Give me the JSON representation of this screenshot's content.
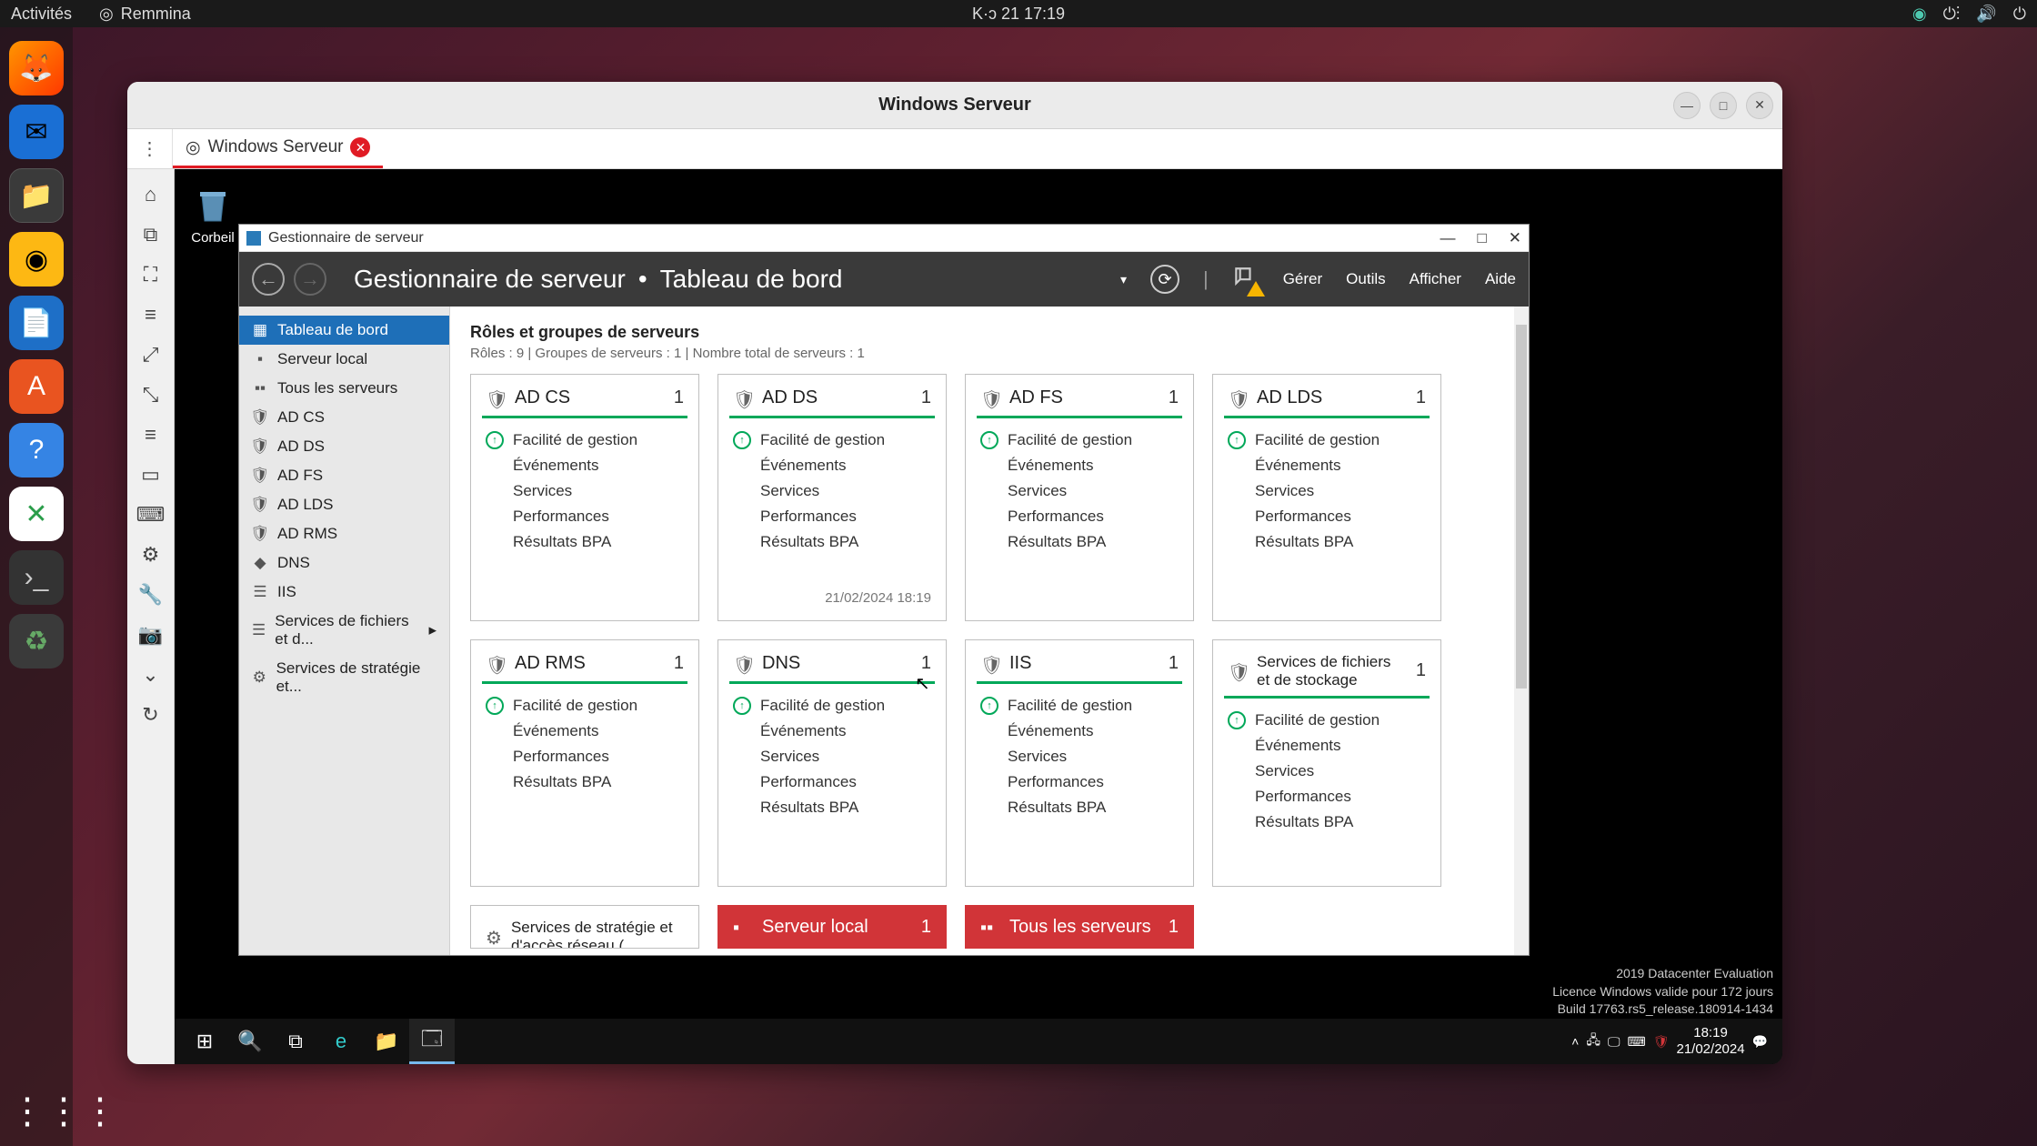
{
  "gnome": {
    "activities": "Activités",
    "app": "Remmina",
    "clock": "K·ɔ 21  17:19"
  },
  "remmina": {
    "title": "Windows Serveur",
    "tab": "Windows Serveur"
  },
  "win": {
    "recycle": "Corbeil"
  },
  "sm": {
    "title": "Gestionnaire de serveur",
    "breadcrumb1": "Gestionnaire de serveur",
    "breadcrumb2": "Tableau de bord",
    "menu": {
      "manage": "Gérer",
      "tools": "Outils",
      "view": "Afficher",
      "help": "Aide"
    },
    "side": {
      "dashboard": "Tableau de bord",
      "local": "Serveur local",
      "all": "Tous les serveurs",
      "adcs": "AD CS",
      "adds": "AD DS",
      "adfs": "AD FS",
      "adlds": "AD LDS",
      "adrms": "AD RMS",
      "dns": "DNS",
      "iis": "IIS",
      "files": "Services de fichiers et d...",
      "strategy": "Services de stratégie et..."
    },
    "section": {
      "title": "Rôles et groupes de serveurs",
      "sub": "Rôles : 9   |   Groupes de serveurs : 1   |   Nombre total de serveurs : 1"
    },
    "rows": {
      "facility": "Facilité de gestion",
      "events": "Événements",
      "services": "Services",
      "perf": "Performances",
      "bpa": "Résultats BPA"
    },
    "tiles": [
      {
        "name": "AD CS",
        "count": "1",
        "rows": [
          "facility",
          "events",
          "services",
          "perf",
          "bpa"
        ]
      },
      {
        "name": "AD DS",
        "count": "1",
        "rows": [
          "facility",
          "events",
          "services",
          "perf",
          "bpa"
        ],
        "timestamp": "21/02/2024 18:19"
      },
      {
        "name": "AD FS",
        "count": "1",
        "rows": [
          "facility",
          "events",
          "services",
          "perf",
          "bpa"
        ]
      },
      {
        "name": "AD LDS",
        "count": "1",
        "rows": [
          "facility",
          "events",
          "services",
          "perf",
          "bpa"
        ]
      },
      {
        "name": "AD RMS",
        "count": "1",
        "rows": [
          "facility",
          "events",
          "perf",
          "bpa"
        ]
      },
      {
        "name": "DNS",
        "count": "1",
        "rows": [
          "facility",
          "events",
          "services",
          "perf",
          "bpa"
        ]
      },
      {
        "name": "IIS",
        "count": "1",
        "rows": [
          "facility",
          "events",
          "services",
          "perf",
          "bpa"
        ]
      },
      {
        "name": "Services de fichiers et de stockage",
        "count": "1",
        "rows": [
          "facility",
          "events",
          "services",
          "perf",
          "bpa"
        ]
      }
    ],
    "bottomTiles": {
      "strategy": "Services de stratégie et d'accès réseau (",
      "local": "Serveur local",
      "all": "Tous les serveurs",
      "count": "1"
    },
    "watermark": {
      "l1": "2019 Datacenter Evaluation",
      "l2": "Licence Windows valide pour 172 jours",
      "l3": "Build 17763.rs5_release.180914-1434"
    }
  },
  "taskbar": {
    "time": "18:19",
    "date": "21/02/2024"
  }
}
